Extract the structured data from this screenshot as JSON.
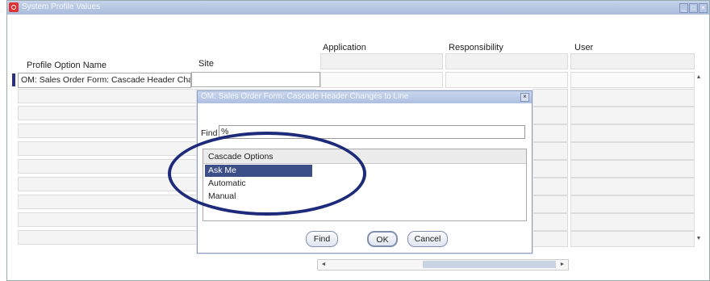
{
  "window": {
    "title": "System Profile Values",
    "controls": [
      "_",
      "□",
      "×"
    ]
  },
  "columns": {
    "profile_option_name": "Profile Option Name",
    "site": "Site",
    "application": "Application",
    "responsibility": "Responsibility",
    "user": "User"
  },
  "first_row": {
    "profile_option_name": "OM: Sales Order Form: Cascade Header Changes to Line",
    "site": ""
  },
  "scrollbars": {
    "up_arrow": "▲",
    "down_arrow": "▼",
    "left_arrow": "◄",
    "right_arrow": "►"
  },
  "dialog": {
    "title": "OM: Sales Order Form: Cascade Header Changes to Line",
    "close": "×",
    "find_label": "Find",
    "find_value": "%",
    "list_header": "Cascade Options",
    "options": [
      {
        "label": "Ask Me",
        "selected": true
      },
      {
        "label": "Automatic",
        "selected": false
      },
      {
        "label": "Manual",
        "selected": false
      }
    ],
    "buttons": {
      "find": "Find",
      "ok": "OK",
      "cancel": "Cancel"
    }
  },
  "colors": {
    "title_bar": "#b5c6e4",
    "selection": "#3d4f88",
    "highlight_ellipse": "#1e2a7a"
  }
}
